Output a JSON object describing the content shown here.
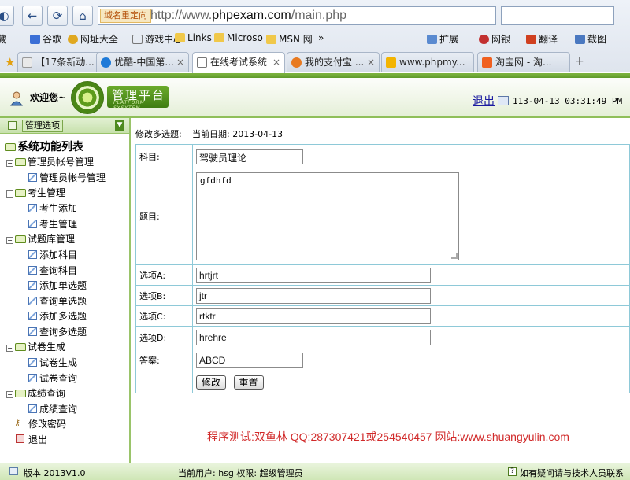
{
  "browser": {
    "address_redirect": "域名重定向",
    "url_prefix": "http://www.",
    "url_domain": "phpexam.com",
    "url_path": "/main.php",
    "favorites": [
      "藏",
      "谷歌",
      "网址大全",
      "游戏中心",
      "Links",
      "Microso",
      "MSN 网",
      "»",
      "扩展",
      "网银",
      "翻译",
      "截图"
    ],
    "tabs": [
      {
        "label": "【17条新动..."
      },
      {
        "label": "优酷-中国第..."
      },
      {
        "label": "在线考试系统"
      },
      {
        "label": "我的支付宝 ..."
      },
      {
        "label": "www.phpmy..."
      },
      {
        "label": "淘宝网 - 淘..."
      }
    ]
  },
  "header": {
    "welcome": "欢迎您~",
    "logo_title": "管理平台",
    "logo_sub": "PLATFORM SYSYTEM",
    "logout": "退出",
    "datetime": "113-04-13 03:31:49 PM"
  },
  "sidebar": {
    "panel_label": "管理选项",
    "tree_title": "系统功能列表",
    "groups": [
      {
        "label": "管理员帐号管理",
        "items": [
          "管理员帐号管理"
        ]
      },
      {
        "label": "考生管理",
        "items": [
          "考生添加",
          "考生管理"
        ]
      },
      {
        "label": "试题库管理",
        "items": [
          "添加科目",
          "查询科目",
          "添加单选题",
          "查询单选题",
          "添加多选题",
          "查询多选题"
        ]
      },
      {
        "label": "试卷生成",
        "items": [
          "试卷生成",
          "试卷查询"
        ]
      },
      {
        "label": "成绩查询",
        "items": [
          "成绩查询"
        ]
      }
    ],
    "extra": [
      "修改密码",
      "退出"
    ]
  },
  "form": {
    "title": "修改多选题:",
    "date": "当前日期: 2013-04-13",
    "rows": {
      "subject": {
        "label": "科目:",
        "value": "驾驶员理论"
      },
      "question": {
        "label": "题目:",
        "value": "gfdhfd"
      },
      "option_a": {
        "label": "选项A:",
        "value": "hrtjrt"
      },
      "option_b": {
        "label": "选项B:",
        "value": "jtr"
      },
      "option_c": {
        "label": "选项C:",
        "value": "rtktr"
      },
      "option_d": {
        "label": "选项D:",
        "value": "hrehre"
      },
      "answer": {
        "label": "答案:",
        "value": "ABCD"
      }
    },
    "modify_button": "修改",
    "reset_button": "重置"
  },
  "watermark": "程序测试:双鱼林 QQ:287307421或254540457 网站:www.shuangyulin.com",
  "statusbar": {
    "version": "版本 2013V1.0",
    "user": "当前用户: hsg 权限: 超级管理员",
    "contact": "如有疑问请与技术人员联系"
  },
  "colors": {
    "theme_green": "#6bab2c",
    "border_teal": "#8ec9d8",
    "watermark_red": "#d12a2a"
  }
}
